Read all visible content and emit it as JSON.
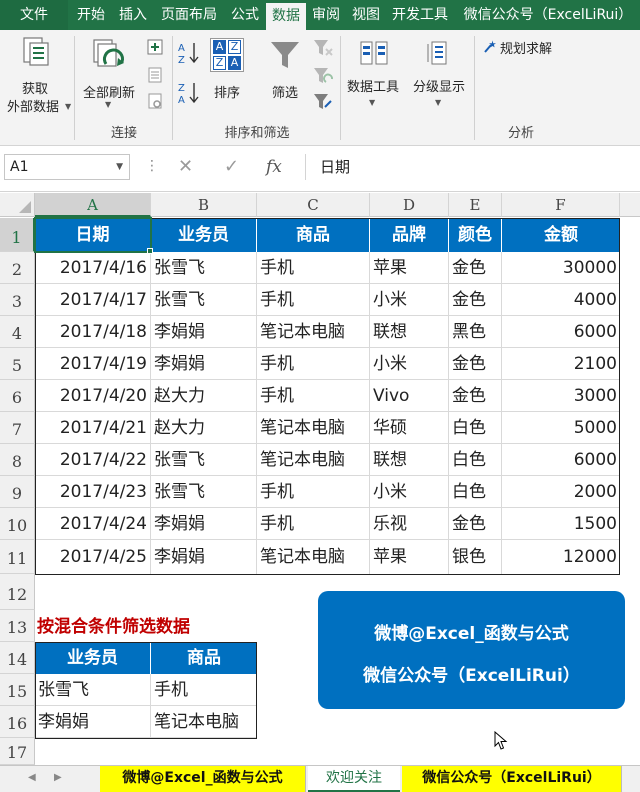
{
  "ribbon": {
    "tabs": [
      {
        "label": "文件",
        "state": "file"
      },
      {
        "label": "开始",
        "state": ""
      },
      {
        "label": "插入",
        "state": ""
      },
      {
        "label": "页面布局",
        "state": ""
      },
      {
        "label": "公式",
        "state": ""
      },
      {
        "label": "数据",
        "state": "active"
      },
      {
        "label": "审阅",
        "state": ""
      },
      {
        "label": "视图",
        "state": ""
      },
      {
        "label": "开发工具",
        "state": ""
      },
      {
        "label": "微信公众号（ExcelLiRui）",
        "state": ""
      }
    ],
    "get_external_1": "获取",
    "get_external_2": "外部数据",
    "refresh_all": "全部刷新",
    "sort": "排序",
    "filter": "筛选",
    "data_tools": "数据工具",
    "outline": "分级显示",
    "solver": "规划求解",
    "group_connections": "连接",
    "group_sort_filter": "排序和筛选",
    "group_analysis": "分析",
    "sort_az_top": "A",
    "sort_az_bottom": "Z"
  },
  "formula_bar": {
    "name_box": "A1",
    "fx": "fx",
    "content": "日期"
  },
  "columns": [
    "A",
    "B",
    "C",
    "D",
    "E",
    "F"
  ],
  "rows": [
    "1",
    "2",
    "3",
    "4",
    "5",
    "6",
    "7",
    "8",
    "9",
    "10",
    "11",
    "12",
    "13",
    "14",
    "15",
    "16",
    "17"
  ],
  "table": {
    "headers": [
      "日期",
      "业务员",
      "商品",
      "品牌",
      "颜色",
      "金额"
    ],
    "rows": [
      [
        "2017/4/16",
        "张雪飞",
        "手机",
        "苹果",
        "金色",
        "30000"
      ],
      [
        "2017/4/17",
        "张雪飞",
        "手机",
        "小米",
        "金色",
        "4000"
      ],
      [
        "2017/4/18",
        "李娟娟",
        "笔记本电脑",
        "联想",
        "黑色",
        "6000"
      ],
      [
        "2017/4/19",
        "李娟娟",
        "手机",
        "小米",
        "金色",
        "2100"
      ],
      [
        "2017/4/20",
        "赵大力",
        "手机",
        "Vivo",
        "金色",
        "3000"
      ],
      [
        "2017/4/21",
        "赵大力",
        "笔记本电脑",
        "华硕",
        "白色",
        "5000"
      ],
      [
        "2017/4/22",
        "张雪飞",
        "笔记本电脑",
        "联想",
        "白色",
        "6000"
      ],
      [
        "2017/4/23",
        "张雪飞",
        "手机",
        "小米",
        "白色",
        "2000"
      ],
      [
        "2017/4/24",
        "李娟娟",
        "手机",
        "乐视",
        "金色",
        "1500"
      ],
      [
        "2017/4/25",
        "李娟娟",
        "笔记本电脑",
        "苹果",
        "银色",
        "12000"
      ]
    ]
  },
  "criteria": {
    "title": "按混合条件筛选数据",
    "headers": [
      "业务员",
      "商品"
    ],
    "rows": [
      [
        "张雪飞",
        "手机"
      ],
      [
        "李娟娟",
        "笔记本电脑"
      ]
    ]
  },
  "promo": {
    "line1": "微博@Excel_函数与公式",
    "line2": "微信公众号（ExcelLiRui）"
  },
  "sheet_tabs": [
    {
      "label": "微博@Excel_函数与公式",
      "state": "yellow"
    },
    {
      "label": "欢迎关注",
      "state": "current"
    },
    {
      "label": "微信公众号（ExcelLiRui）",
      "state": "yellow"
    }
  ],
  "colors": {
    "excel_green": "#217346",
    "header_blue": "#0070c0",
    "criteria_red": "#c00000",
    "sheet_tab_yellow": "#ffff00"
  }
}
